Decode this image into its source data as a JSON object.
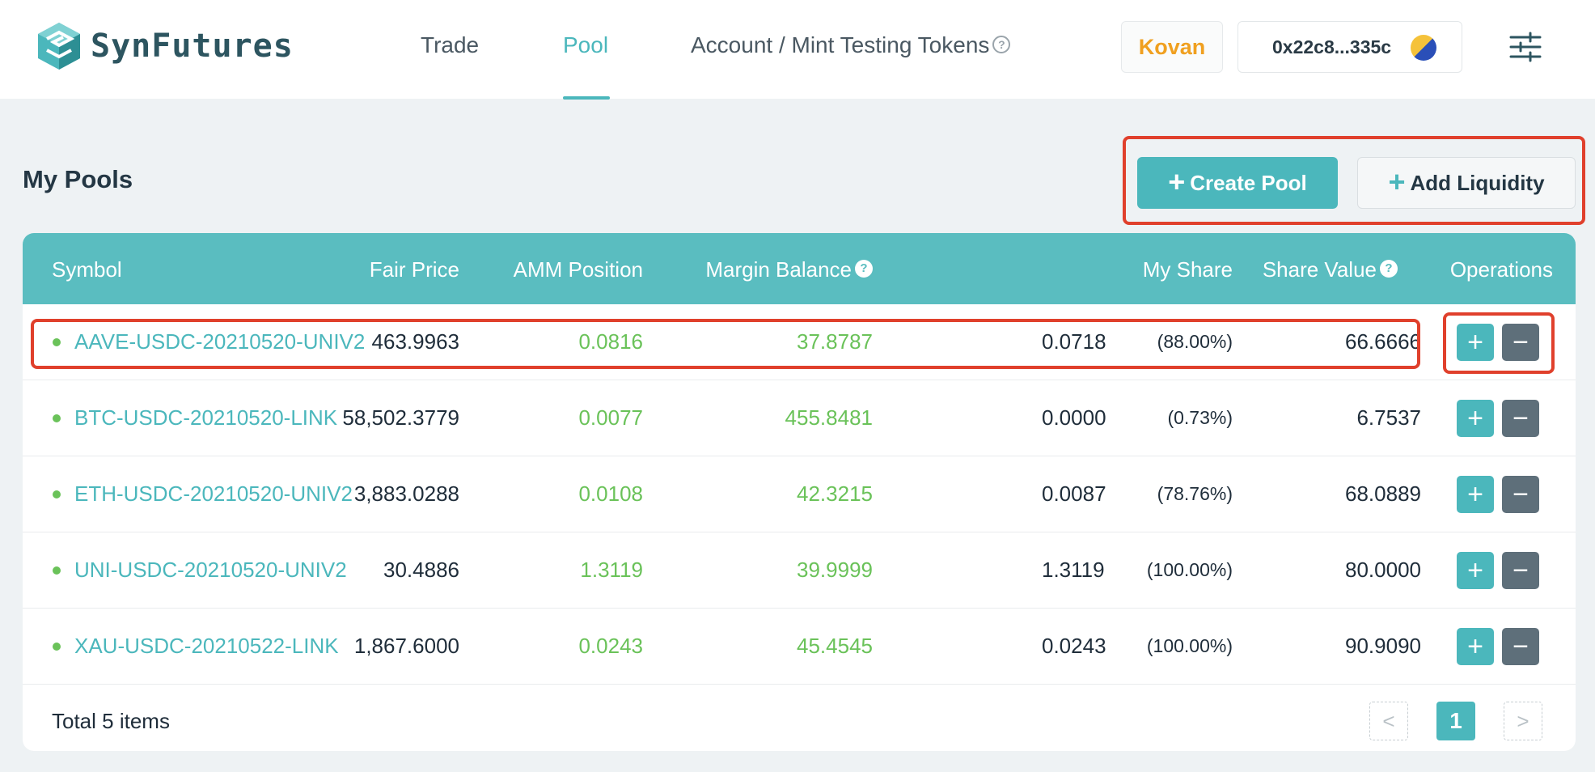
{
  "app": {
    "brand": "SynFutures",
    "colors": {
      "accent": "#4bb7bc",
      "positive": "#6ac259",
      "network": "#f0a020",
      "highlight": "#e0402c",
      "minus_button": "#5e6f7a"
    }
  },
  "nav": {
    "items": [
      {
        "label": "Trade",
        "active": false
      },
      {
        "label": "Pool",
        "active": true
      },
      {
        "label": "Account / Mint Testing Tokens",
        "active": false,
        "icon": "help-icon"
      }
    ]
  },
  "header": {
    "network": "Kovan",
    "wallet": "0x22c8...335c",
    "settings_icon": "sliders-icon"
  },
  "page": {
    "title": "My Pools",
    "create_pool": "Create Pool",
    "add_liquidity": "Add Liquidity"
  },
  "table": {
    "columns": [
      "Symbol",
      "Fair Price",
      "AMM Position",
      "Margin Balance",
      "My Share",
      "Share Value",
      "Operations"
    ],
    "rows": [
      {
        "symbol": "AAVE-USDC-20210520-UNIV2",
        "fair_price": "463.9963",
        "amm_position": "0.0816",
        "margin_balance": "37.8787",
        "my_share": "0.0718",
        "share_pct": "(88.00%)",
        "share_value": "66.6666"
      },
      {
        "symbol": "BTC-USDC-20210520-LINK",
        "fair_price": "58,502.3779",
        "amm_position": "0.0077",
        "margin_balance": "455.8481",
        "my_share": "0.0000",
        "share_pct": "(0.73%)",
        "share_value": "6.7537"
      },
      {
        "symbol": "ETH-USDC-20210520-UNIV2",
        "fair_price": "3,883.0288",
        "amm_position": "0.0108",
        "margin_balance": "42.3215",
        "my_share": "0.0087",
        "share_pct": "(78.76%)",
        "share_value": "68.0889"
      },
      {
        "symbol": "UNI-USDC-20210520-UNIV2",
        "fair_price": "30.4886",
        "amm_position": "1.3119",
        "margin_balance": "39.9999",
        "my_share": "1.3119",
        "share_pct": "(100.00%)",
        "share_value": "80.0000"
      },
      {
        "symbol": "XAU-USDC-20210522-LINK",
        "fair_price": "1,867.6000",
        "amm_position": "0.0243",
        "margin_balance": "45.4545",
        "my_share": "0.0243",
        "share_pct": "(100.00%)",
        "share_value": "90.9090"
      }
    ],
    "op_plus": "+",
    "op_minus": "−"
  },
  "footer": {
    "total": "Total 5 items",
    "prev": "<",
    "page": "1",
    "next": ">"
  }
}
